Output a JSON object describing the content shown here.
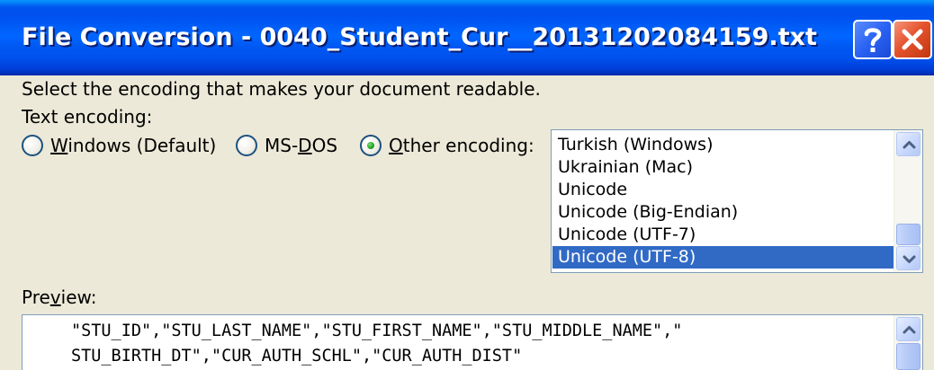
{
  "dialog": {
    "title": "File Conversion - 0040_Student_Cur__20131202084159.txt",
    "help_label": "?",
    "close_label": "Close"
  },
  "instruction": "Select the encoding that makes your document readable.",
  "text_encoding": {
    "label": "Text encoding:",
    "options": [
      {
        "label": "Windows (Default)",
        "access_key": "W",
        "selected": false
      },
      {
        "label": "MS-DOS",
        "access_key": "D",
        "selected": false
      },
      {
        "label": "Other encoding:",
        "access_key": "O",
        "selected": true
      }
    ]
  },
  "encoding_list": {
    "items": [
      "Turkish (Windows)",
      "Ukrainian (Mac)",
      "Unicode",
      "Unicode (Big-Endian)",
      "Unicode (UTF-7)",
      "Unicode (UTF-8)"
    ],
    "selected": "Unicode (UTF-8)"
  },
  "preview": {
    "label": "Preview:",
    "access_key": "v",
    "lines": [
      "\"STU_ID\",\"STU_LAST_NAME\",\"STU_FIRST_NAME\",\"STU_MIDDLE_NAME\",\"",
      "STU_BIRTH_DT\",\"CUR_AUTH_SCHL\",\"CUR_AUTH_DIST\""
    ]
  },
  "colors": {
    "title_bar": "#0054e3",
    "selection": "#316ac5",
    "dialog_face": "#ece9d8",
    "radio_dot": "#21a121"
  },
  "icons": {
    "help": "question-mark-icon",
    "close": "close-x-icon",
    "scroll_up": "chevron-up-icon",
    "scroll_down": "chevron-down-icon"
  }
}
